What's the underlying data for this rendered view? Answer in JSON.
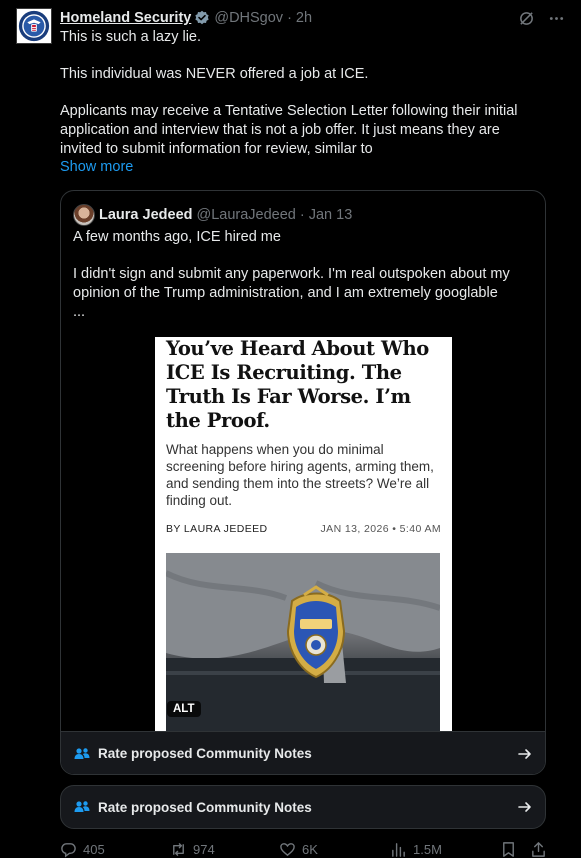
{
  "post": {
    "author_name": "Homeland Security",
    "author_handle": "@DHSgov",
    "separator": "·",
    "time": "2h",
    "paragraphs": [
      "This is such a lazy lie.",
      "This individual was NEVER offered a job at ICE.",
      "Applicants may receive a Tentative Selection Letter following their initial application and interview that is not a job offer. It just means they are invited to submit information for review, similar to"
    ],
    "show_more": "Show more"
  },
  "quote": {
    "author_name": "Laura Jedeed",
    "author_handle": "@LauraJedeed",
    "separator": "·",
    "date": "Jan 13",
    "paragraphs": [
      "A few months ago, ICE hired me",
      "I didn't sign and submit any paperwork. I'm real outspoken about my opinion of the Trump administration, and I am extremely googlable",
      "..."
    ],
    "article": {
      "headline": "You’ve Heard About Who ICE Is Recruiting. The Truth Is Far Worse. I’m the Proof.",
      "dek": "What happens when you do minimal screening before hiring agents, arming them, and sending them into the streets? We’re all finding out.",
      "byline": "BY LAURA JEDEED",
      "date": "JAN 13, 2026 • 5:40 AM",
      "alt_badge": "ALT"
    },
    "notes_label": "Rate proposed Community Notes"
  },
  "notes_label": "Rate proposed Community Notes",
  "actions": {
    "replies": "405",
    "reposts": "974",
    "likes": "6K",
    "views": "1.5M"
  },
  "colors": {
    "background": "#000000",
    "text": "#e7e9ea",
    "muted": "#71767b",
    "link": "#1d9bf0",
    "border": "#2f3336",
    "verified_badge": "#829aab"
  },
  "icons": {
    "verified": "verified-badge-icon",
    "grok": "grok-icon",
    "more": "more-icon",
    "community_notes": "community-notes-icon",
    "arrow": "arrow-right-icon",
    "reply": "reply-icon",
    "repost": "repost-icon",
    "like": "heart-icon",
    "views": "views-icon",
    "bookmark": "bookmark-icon",
    "share": "share-icon"
  }
}
